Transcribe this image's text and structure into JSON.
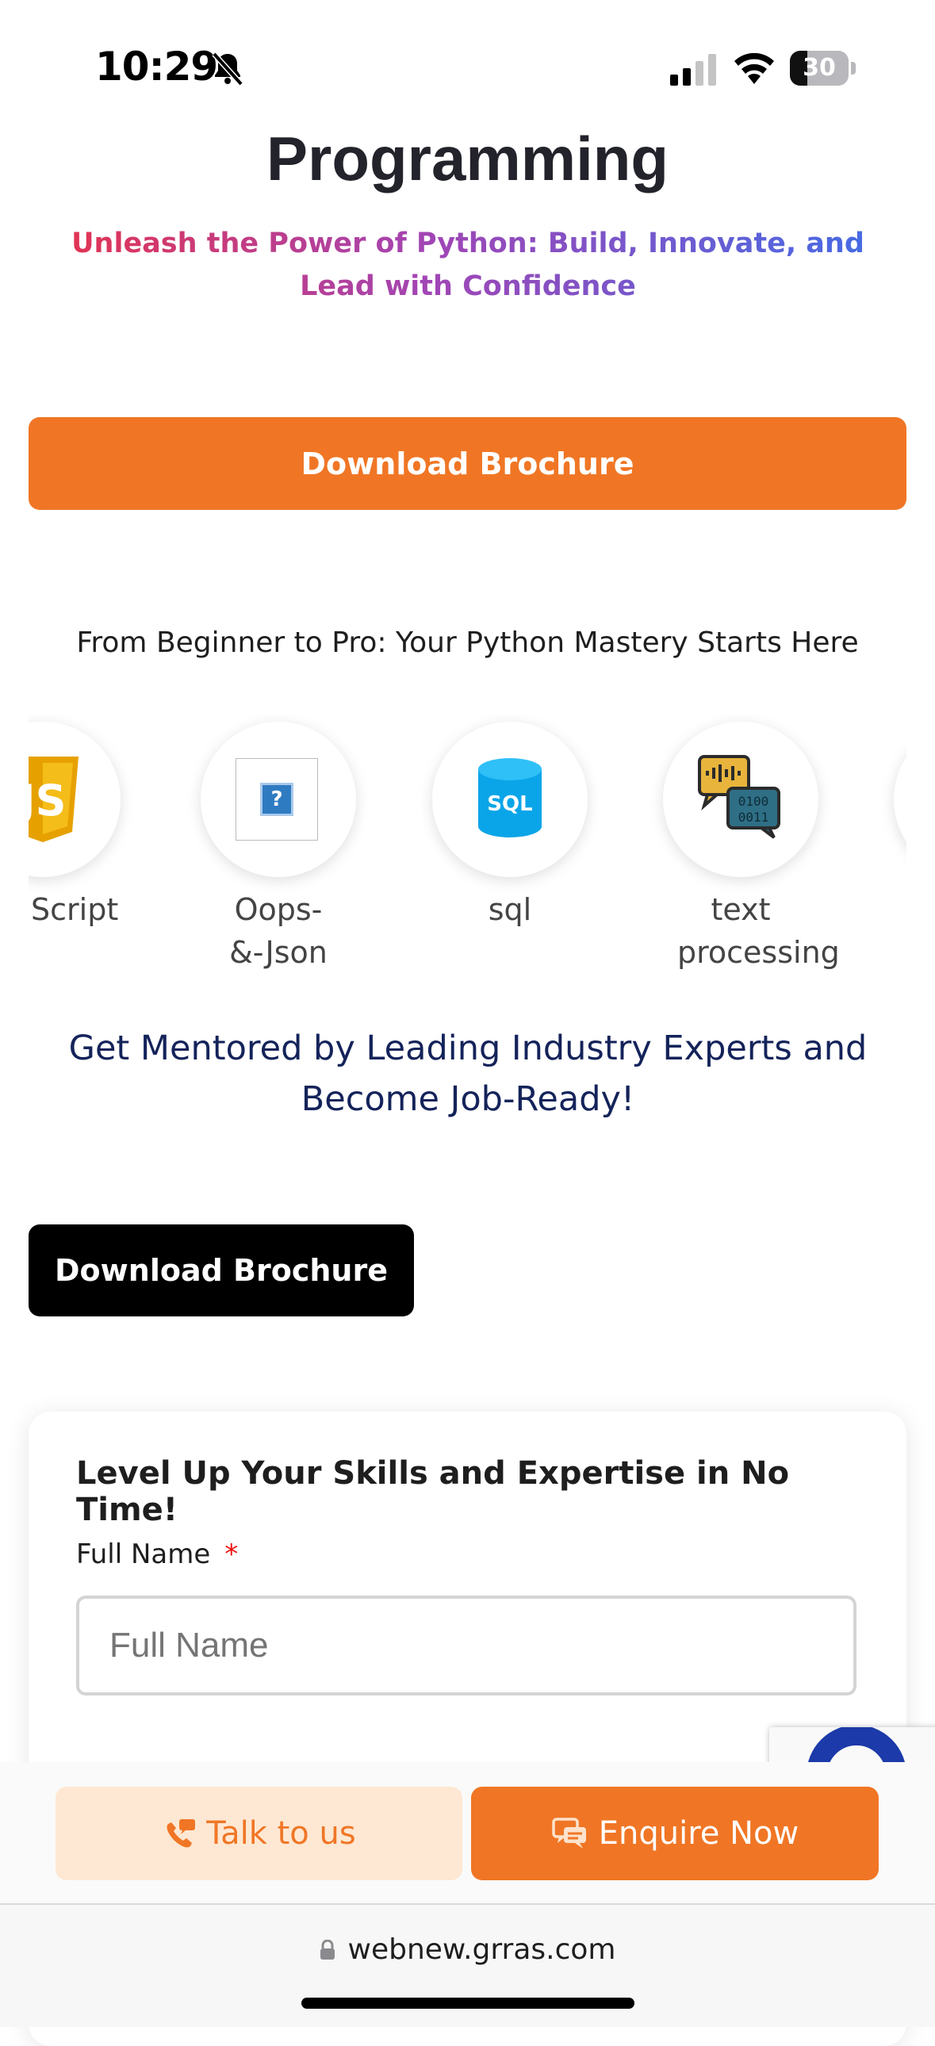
{
  "status_bar": {
    "time": "10:29",
    "battery": "30"
  },
  "header": {
    "title": "Programming",
    "tagline": "Unleash the Power of Python: Build, Innovate, and Lead with Confidence"
  },
  "cta_primary": {
    "label": "Download Brochure"
  },
  "skills": {
    "heading": "From Beginner to Pro: Your Python Mastery Starts Here",
    "items": [
      {
        "label": "JavaScript",
        "icon": "javascript-icon"
      },
      {
        "label": "Oops-&-Json",
        "icon": "broken-image-icon"
      },
      {
        "label": "sql",
        "icon": "sql-database-icon"
      },
      {
        "label": "text processing",
        "icon": "text-processing-icon"
      }
    ]
  },
  "mentor": {
    "text": "Get Mentored by Leading Industry Experts and Become Job-Ready!"
  },
  "cta_secondary": {
    "label": "Download Brochure"
  },
  "form": {
    "title": "Level Up Your Skills and Expertise in No Time!",
    "full_name_label": "Full Name",
    "required_mark": "*",
    "full_name_placeholder": "Full Name"
  },
  "sticky_bar": {
    "talk_label": "Talk to us",
    "enquire_label": "Enquire Now"
  },
  "browser": {
    "url": "webnew.grras.com"
  },
  "colors": {
    "accent": "#f07625",
    "accent_light": "#fee8d3",
    "mentor_text": "#14235a"
  }
}
